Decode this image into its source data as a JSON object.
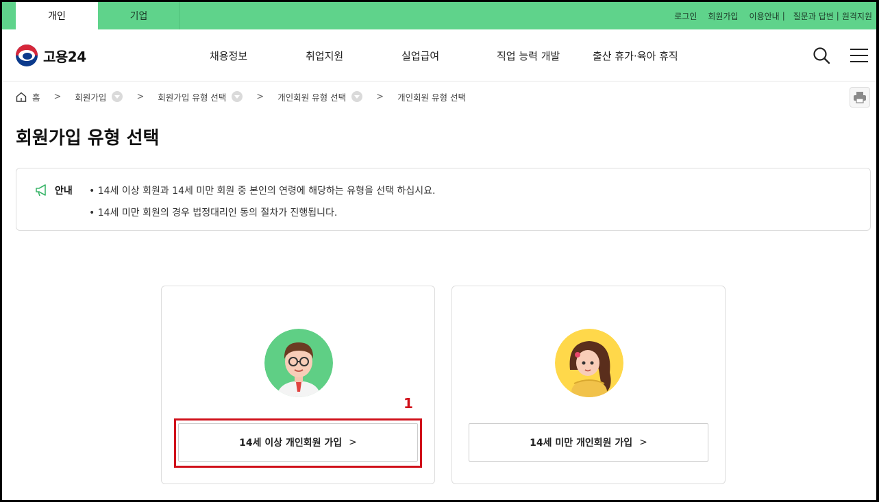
{
  "topbar": {
    "tabs": [
      {
        "label": "개인"
      },
      {
        "label": "기업"
      }
    ],
    "utility": [
      "로그인",
      "회원가입",
      "이용안내",
      "질문과 답변",
      "원격지원"
    ],
    "separator": "|"
  },
  "header": {
    "logo": "고용24",
    "nav": [
      "채용정보",
      "취업지원",
      "실업급여",
      "직업 능력 개발",
      "출산 휴가·육아 휴직"
    ]
  },
  "breadcrumb": [
    "홈",
    "회원가입",
    "회원가입 유형 선택",
    "개인회원 유형 선택",
    "개인회원 유형 선택"
  ],
  "page_title": "회원가입 유형 선택",
  "notice": {
    "title": "안내",
    "items": [
      "14세 이상 회원과 14세 미만 회원 중 본인의 연령에 해당하는 유형을 선택 하십시요.",
      "14세 미만 회원의 경우 법정대리인 동의 절차가 진행됩니다."
    ]
  },
  "cards": [
    {
      "button": "14세 이상 개인회원 가입",
      "avatar_color": "#5fcf85"
    },
    {
      "button": "14세 미만 개인회원 가입",
      "avatar_color": "#ffd84a"
    }
  ],
  "annotation": {
    "number": "1",
    "color": "#d0101a"
  },
  "colors": {
    "brand_green": "#5fd38b"
  }
}
